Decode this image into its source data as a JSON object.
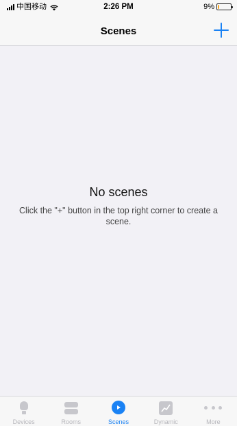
{
  "status_bar": {
    "carrier": "中国移动",
    "time": "2:26 PM",
    "battery_percent": "9%",
    "battery_level": 0.09
  },
  "nav": {
    "title": "Scenes",
    "add_icon": "plus-icon"
  },
  "empty_state": {
    "title": "No scenes",
    "description": "Click the \"+\" button in the top right corner to create a scene."
  },
  "tabs": [
    {
      "label": "Devices",
      "icon": "bulb-icon",
      "active": false
    },
    {
      "label": "Rooms",
      "icon": "rooms-icon",
      "active": false
    },
    {
      "label": "Scenes",
      "icon": "play-icon",
      "active": true
    },
    {
      "label": "Dynamic",
      "icon": "chart-icon",
      "active": false
    },
    {
      "label": "More",
      "icon": "more-icon",
      "active": false
    }
  ],
  "colors": {
    "accent": "#1a82f4",
    "inactive": "#b5b5ba",
    "background": "#f2f1f6",
    "battery_low": "#f5a623"
  }
}
